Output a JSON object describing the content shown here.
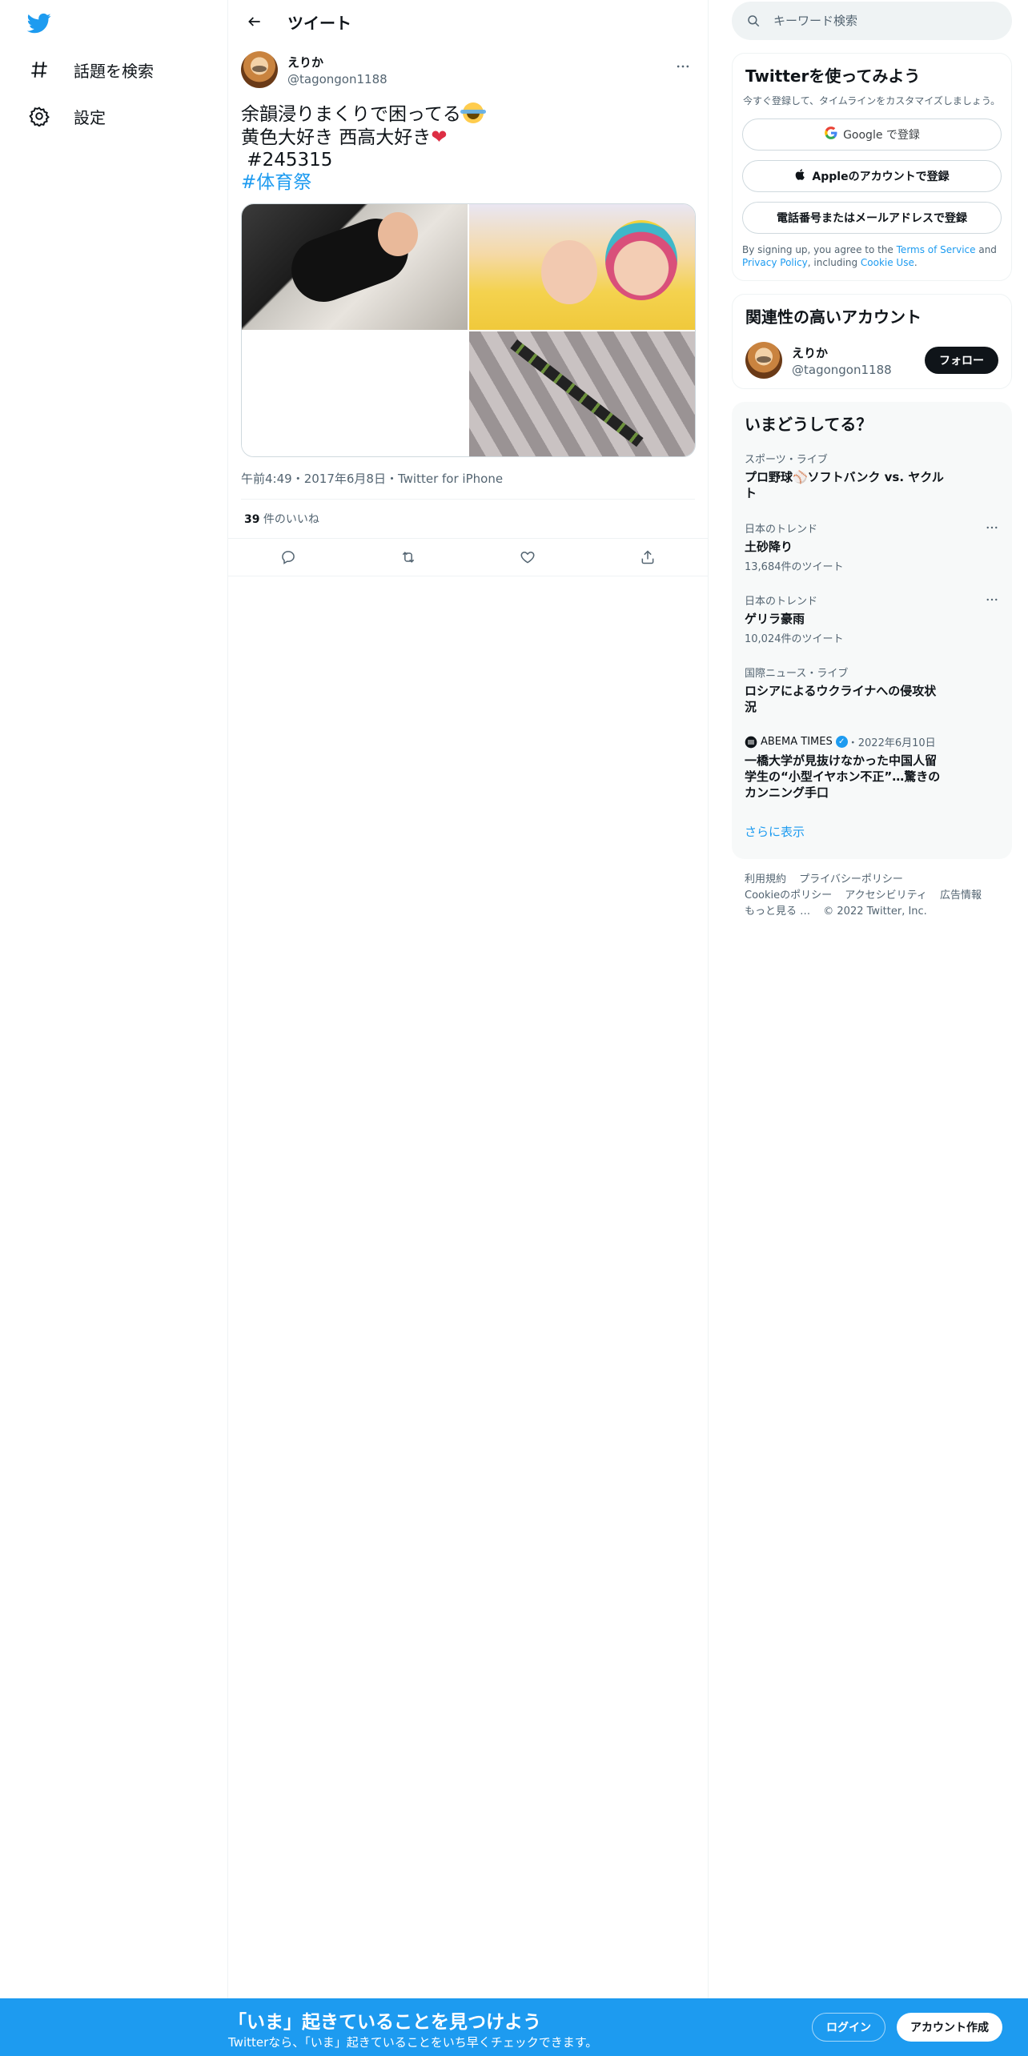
{
  "nav": {
    "logo": "twitter-bird-icon",
    "items": [
      {
        "label": "話題を検索",
        "icon": "hashtag-icon"
      },
      {
        "label": "設定",
        "icon": "gear-icon"
      }
    ]
  },
  "main": {
    "header_title": "ツイート",
    "tweet": {
      "author_name": "えりか",
      "author_handle": "@tagongon1188",
      "text_line1": "余韻浸りまくりで困ってる",
      "text_line2": "黄色大好き 西高大好き",
      "text_line3": " #245315",
      "hashtag": "#体育祭",
      "time": "午前4:49",
      "dot1": "・",
      "date": "2017年6月8日",
      "dot2": "・",
      "source": "Twitter for iPhone",
      "likes_count": "39",
      "likes_label": " 件のいいね"
    }
  },
  "sidebar": {
    "search_placeholder": "キーワード検索",
    "signup": {
      "title": "Twitterを使ってみよう",
      "subtitle": "今すぐ登録して、タイムラインをカスタマイズしましょう。",
      "google": "Google で登録",
      "apple": "Appleのアカウントで登録",
      "phone": "電話番号またはメールアドレスで登録",
      "legal_1": "By signing up, you agree to the ",
      "terms": "Terms of Service",
      "legal_2": " and ",
      "privacy": "Privacy Policy",
      "legal_3": ", including ",
      "cookie": "Cookie Use",
      "legal_4": "."
    },
    "related": {
      "title": "関連性の高いアカウント",
      "name": "えりか",
      "handle": "@tagongon1188",
      "follow": "フォロー"
    },
    "trends": {
      "title": "いまどうしてる？",
      "items": [
        {
          "context": "スポーツ・ライブ",
          "title": "プロ野球⚾ソフトバンク vs. ヤクルト",
          "count": ""
        },
        {
          "context": "日本のトレンド",
          "title": "土砂降り",
          "count": "13,684件のツイート"
        },
        {
          "context": "日本のトレンド",
          "title": "ゲリラ豪雨",
          "count": "10,024件のツイート"
        },
        {
          "context": "国際ニュース・ライブ",
          "title": "ロシアによるウクライナへの侵攻状況",
          "count": ""
        }
      ],
      "news": {
        "source": "ABEMA TIMES",
        "dot": "・",
        "date": "2022年6月10日",
        "title": "一橋大学が見抜けなかった中国人留学生の“小型イヤホン不正”…驚きのカンニング手口"
      },
      "show_more": "さらに表示"
    },
    "footer": {
      "links": [
        "利用規約",
        "プライバシーポリシー",
        "Cookieのポリシー",
        "アクセシビリティ",
        "広告情報",
        "もっと見る …",
        "© 2022 Twitter, Inc."
      ]
    }
  },
  "bottom_bar": {
    "title": "「いま」起きていることを見つけよう",
    "subtitle": "Twitterなら、「いま」起きていることをいち早くチェックできます。",
    "login": "ログイン",
    "signup": "アカウント作成"
  },
  "colors": {
    "accent": "#1d9bf0",
    "text": "#0f1419",
    "secondary": "#536471"
  }
}
